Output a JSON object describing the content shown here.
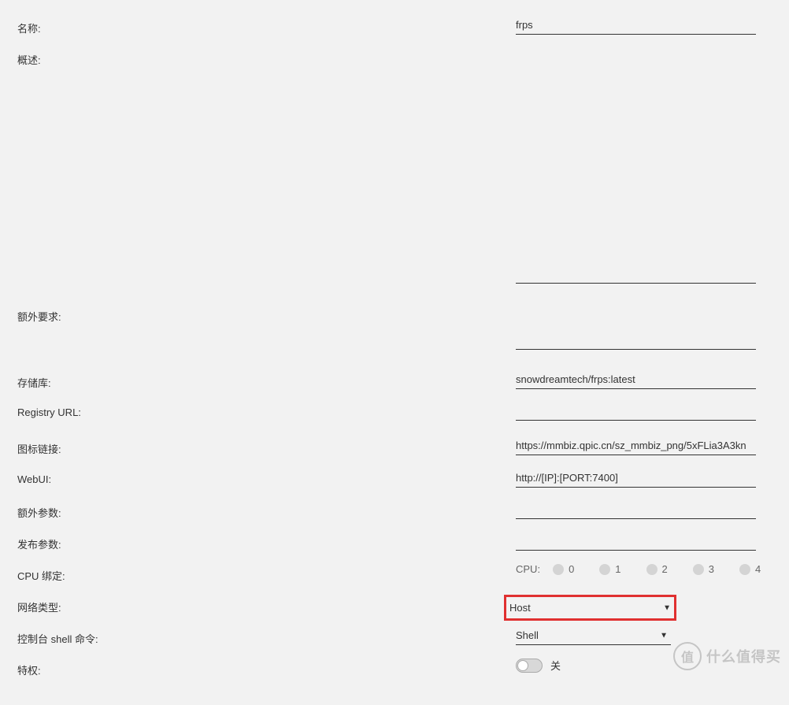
{
  "labels": {
    "name": "名称:",
    "description": "概述:",
    "extra_requirements": "额外要求:",
    "repository": "存储库:",
    "registry_url": "Registry URL:",
    "icon_link": "图标链接:",
    "webui": "WebUI:",
    "extra_args": "额外参数:",
    "publish_args": "发布参数:",
    "cpu_binding": "CPU 绑定:",
    "network_type": "网络类型:",
    "console_shell": "控制台 shell 命令:",
    "privilege": "特权:"
  },
  "values": {
    "name": "frps",
    "description": "",
    "extra_requirements": "",
    "repository": "snowdreamtech/frps:latest",
    "registry_url": "",
    "icon_link": "https://mmbiz.qpic.cn/sz_mmbiz_png/5xFLia3A3kn",
    "webui": "http://[IP]:[PORT:7400]",
    "extra_args": "",
    "publish_args": "",
    "network_type": "Host",
    "console_shell": "Shell",
    "privilege_state": "关"
  },
  "cpu": {
    "prefix": "CPU:",
    "options": [
      "0",
      "1",
      "2",
      "3",
      "4"
    ]
  },
  "watermark": {
    "icon_text": "值",
    "text": "什么值得买"
  }
}
